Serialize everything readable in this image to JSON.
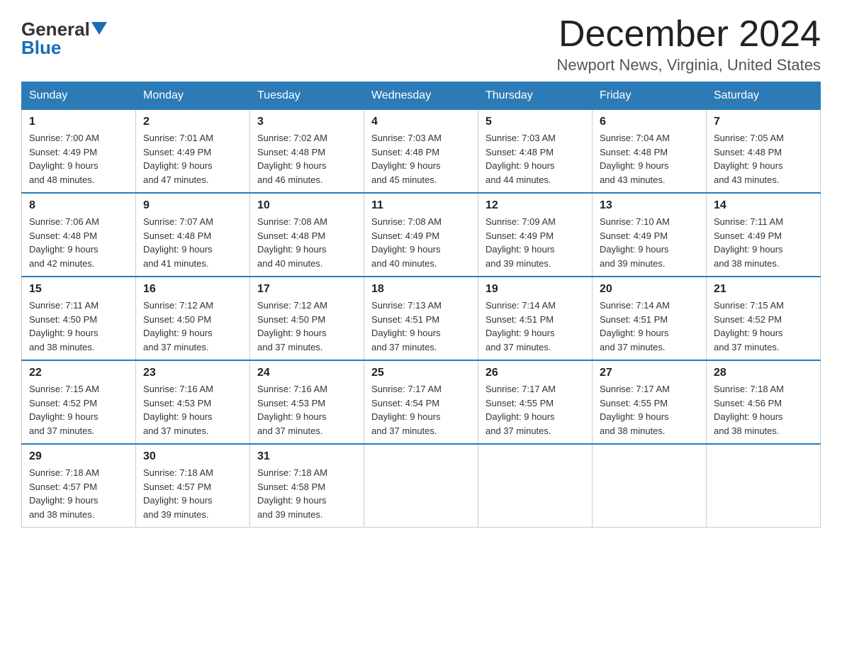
{
  "header": {
    "logo_general": "General",
    "logo_blue": "Blue",
    "month_title": "December 2024",
    "location": "Newport News, Virginia, United States"
  },
  "weekdays": [
    "Sunday",
    "Monday",
    "Tuesday",
    "Wednesday",
    "Thursday",
    "Friday",
    "Saturday"
  ],
  "weeks": [
    [
      {
        "day": "1",
        "sunrise": "7:00 AM",
        "sunset": "4:49 PM",
        "daylight": "9 hours and 48 minutes."
      },
      {
        "day": "2",
        "sunrise": "7:01 AM",
        "sunset": "4:49 PM",
        "daylight": "9 hours and 47 minutes."
      },
      {
        "day": "3",
        "sunrise": "7:02 AM",
        "sunset": "4:48 PM",
        "daylight": "9 hours and 46 minutes."
      },
      {
        "day": "4",
        "sunrise": "7:03 AM",
        "sunset": "4:48 PM",
        "daylight": "9 hours and 45 minutes."
      },
      {
        "day": "5",
        "sunrise": "7:03 AM",
        "sunset": "4:48 PM",
        "daylight": "9 hours and 44 minutes."
      },
      {
        "day": "6",
        "sunrise": "7:04 AM",
        "sunset": "4:48 PM",
        "daylight": "9 hours and 43 minutes."
      },
      {
        "day": "7",
        "sunrise": "7:05 AM",
        "sunset": "4:48 PM",
        "daylight": "9 hours and 43 minutes."
      }
    ],
    [
      {
        "day": "8",
        "sunrise": "7:06 AM",
        "sunset": "4:48 PM",
        "daylight": "9 hours and 42 minutes."
      },
      {
        "day": "9",
        "sunrise": "7:07 AM",
        "sunset": "4:48 PM",
        "daylight": "9 hours and 41 minutes."
      },
      {
        "day": "10",
        "sunrise": "7:08 AM",
        "sunset": "4:48 PM",
        "daylight": "9 hours and 40 minutes."
      },
      {
        "day": "11",
        "sunrise": "7:08 AM",
        "sunset": "4:49 PM",
        "daylight": "9 hours and 40 minutes."
      },
      {
        "day": "12",
        "sunrise": "7:09 AM",
        "sunset": "4:49 PM",
        "daylight": "9 hours and 39 minutes."
      },
      {
        "day": "13",
        "sunrise": "7:10 AM",
        "sunset": "4:49 PM",
        "daylight": "9 hours and 39 minutes."
      },
      {
        "day": "14",
        "sunrise": "7:11 AM",
        "sunset": "4:49 PM",
        "daylight": "9 hours and 38 minutes."
      }
    ],
    [
      {
        "day": "15",
        "sunrise": "7:11 AM",
        "sunset": "4:50 PM",
        "daylight": "9 hours and 38 minutes."
      },
      {
        "day": "16",
        "sunrise": "7:12 AM",
        "sunset": "4:50 PM",
        "daylight": "9 hours and 37 minutes."
      },
      {
        "day": "17",
        "sunrise": "7:12 AM",
        "sunset": "4:50 PM",
        "daylight": "9 hours and 37 minutes."
      },
      {
        "day": "18",
        "sunrise": "7:13 AM",
        "sunset": "4:51 PM",
        "daylight": "9 hours and 37 minutes."
      },
      {
        "day": "19",
        "sunrise": "7:14 AM",
        "sunset": "4:51 PM",
        "daylight": "9 hours and 37 minutes."
      },
      {
        "day": "20",
        "sunrise": "7:14 AM",
        "sunset": "4:51 PM",
        "daylight": "9 hours and 37 minutes."
      },
      {
        "day": "21",
        "sunrise": "7:15 AM",
        "sunset": "4:52 PM",
        "daylight": "9 hours and 37 minutes."
      }
    ],
    [
      {
        "day": "22",
        "sunrise": "7:15 AM",
        "sunset": "4:52 PM",
        "daylight": "9 hours and 37 minutes."
      },
      {
        "day": "23",
        "sunrise": "7:16 AM",
        "sunset": "4:53 PM",
        "daylight": "9 hours and 37 minutes."
      },
      {
        "day": "24",
        "sunrise": "7:16 AM",
        "sunset": "4:53 PM",
        "daylight": "9 hours and 37 minutes."
      },
      {
        "day": "25",
        "sunrise": "7:17 AM",
        "sunset": "4:54 PM",
        "daylight": "9 hours and 37 minutes."
      },
      {
        "day": "26",
        "sunrise": "7:17 AM",
        "sunset": "4:55 PM",
        "daylight": "9 hours and 37 minutes."
      },
      {
        "day": "27",
        "sunrise": "7:17 AM",
        "sunset": "4:55 PM",
        "daylight": "9 hours and 38 minutes."
      },
      {
        "day": "28",
        "sunrise": "7:18 AM",
        "sunset": "4:56 PM",
        "daylight": "9 hours and 38 minutes."
      }
    ],
    [
      {
        "day": "29",
        "sunrise": "7:18 AM",
        "sunset": "4:57 PM",
        "daylight": "9 hours and 38 minutes."
      },
      {
        "day": "30",
        "sunrise": "7:18 AM",
        "sunset": "4:57 PM",
        "daylight": "9 hours and 39 minutes."
      },
      {
        "day": "31",
        "sunrise": "7:18 AM",
        "sunset": "4:58 PM",
        "daylight": "9 hours and 39 minutes."
      },
      null,
      null,
      null,
      null
    ]
  ],
  "labels": {
    "sunrise": "Sunrise:",
    "sunset": "Sunset:",
    "daylight": "Daylight:"
  }
}
